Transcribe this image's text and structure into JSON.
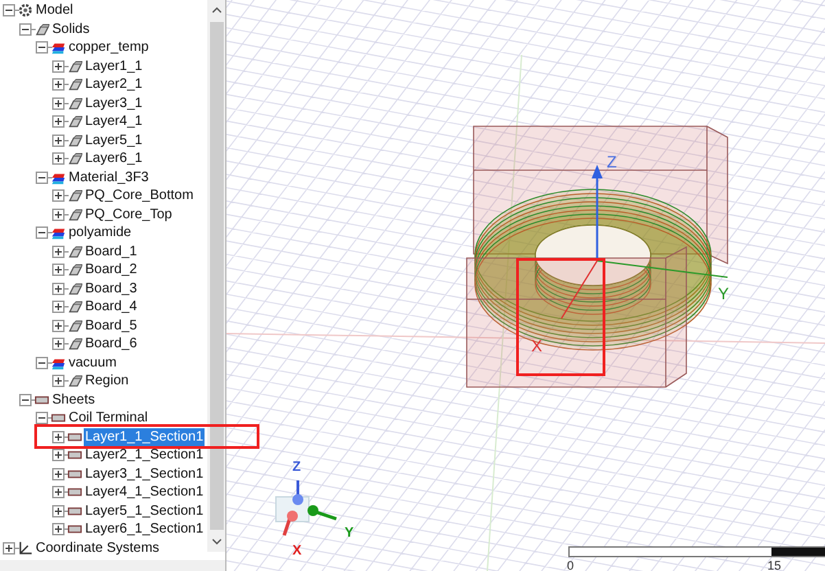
{
  "tree": [
    {
      "label": "Model",
      "kind": "model",
      "expanded": true,
      "selected": false,
      "children": [
        {
          "label": "Solids",
          "kind": "solid",
          "expanded": true,
          "selected": false,
          "children": [
            {
              "label": "copper_temp",
              "kind": "material",
              "expanded": true,
              "selected": false,
              "children": [
                {
                  "label": "Layer1_1",
                  "kind": "solid",
                  "expanded": false,
                  "selected": false
                },
                {
                  "label": "Layer2_1",
                  "kind": "solid",
                  "expanded": false,
                  "selected": false
                },
                {
                  "label": "Layer3_1",
                  "kind": "solid",
                  "expanded": false,
                  "selected": false
                },
                {
                  "label": "Layer4_1",
                  "kind": "solid",
                  "expanded": false,
                  "selected": false
                },
                {
                  "label": "Layer5_1",
                  "kind": "solid",
                  "expanded": false,
                  "selected": false
                },
                {
                  "label": "Layer6_1",
                  "kind": "solid",
                  "expanded": false,
                  "selected": false
                }
              ]
            },
            {
              "label": "Material_3F3",
              "kind": "material",
              "expanded": true,
              "selected": false,
              "children": [
                {
                  "label": "PQ_Core_Bottom",
                  "kind": "solid",
                  "expanded": false,
                  "selected": false
                },
                {
                  "label": "PQ_Core_Top",
                  "kind": "solid",
                  "expanded": false,
                  "selected": false
                }
              ]
            },
            {
              "label": "polyamide",
              "kind": "material",
              "expanded": true,
              "selected": false,
              "children": [
                {
                  "label": "Board_1",
                  "kind": "solid",
                  "expanded": false,
                  "selected": false
                },
                {
                  "label": "Board_2",
                  "kind": "solid",
                  "expanded": false,
                  "selected": false
                },
                {
                  "label": "Board_3",
                  "kind": "solid",
                  "expanded": false,
                  "selected": false
                },
                {
                  "label": "Board_4",
                  "kind": "solid",
                  "expanded": false,
                  "selected": false
                },
                {
                  "label": "Board_5",
                  "kind": "solid",
                  "expanded": false,
                  "selected": false
                },
                {
                  "label": "Board_6",
                  "kind": "solid",
                  "expanded": false,
                  "selected": false
                }
              ]
            },
            {
              "label": "vacuum",
              "kind": "material",
              "expanded": true,
              "selected": false,
              "children": [
                {
                  "label": "Region",
                  "kind": "solid",
                  "expanded": false,
                  "selected": false
                }
              ]
            }
          ]
        },
        {
          "label": "Sheets",
          "kind": "sheet",
          "expanded": true,
          "selected": false,
          "children": [
            {
              "label": "Coil Terminal",
              "kind": "sheet",
              "expanded": true,
              "selected": false,
              "children": [
                {
                  "label": "Layer1_1_Section1",
                  "kind": "sheet",
                  "expanded": false,
                  "selected": true
                },
                {
                  "label": "Layer2_1_Section1",
                  "kind": "sheet",
                  "expanded": false,
                  "selected": false
                },
                {
                  "label": "Layer3_1_Section1",
                  "kind": "sheet",
                  "expanded": false,
                  "selected": false
                },
                {
                  "label": "Layer4_1_Section1",
                  "kind": "sheet",
                  "expanded": false,
                  "selected": false
                },
                {
                  "label": "Layer5_1_Section1",
                  "kind": "sheet",
                  "expanded": false,
                  "selected": false
                },
                {
                  "label": "Layer6_1_Section1",
                  "kind": "sheet",
                  "expanded": false,
                  "selected": false
                }
              ]
            }
          ]
        }
      ]
    },
    {
      "label": "Coordinate Systems",
      "kind": "coords",
      "expanded": false,
      "selected": false
    }
  ],
  "viewport": {
    "model_axes": [
      {
        "label": "Z"
      },
      {
        "label": "X"
      },
      {
        "label": "Y"
      }
    ],
    "triad": [
      {
        "label": "Z"
      },
      {
        "label": "X"
      },
      {
        "label": "Y"
      }
    ],
    "scale_bar": {
      "labels": [
        "0",
        "15"
      ]
    }
  }
}
